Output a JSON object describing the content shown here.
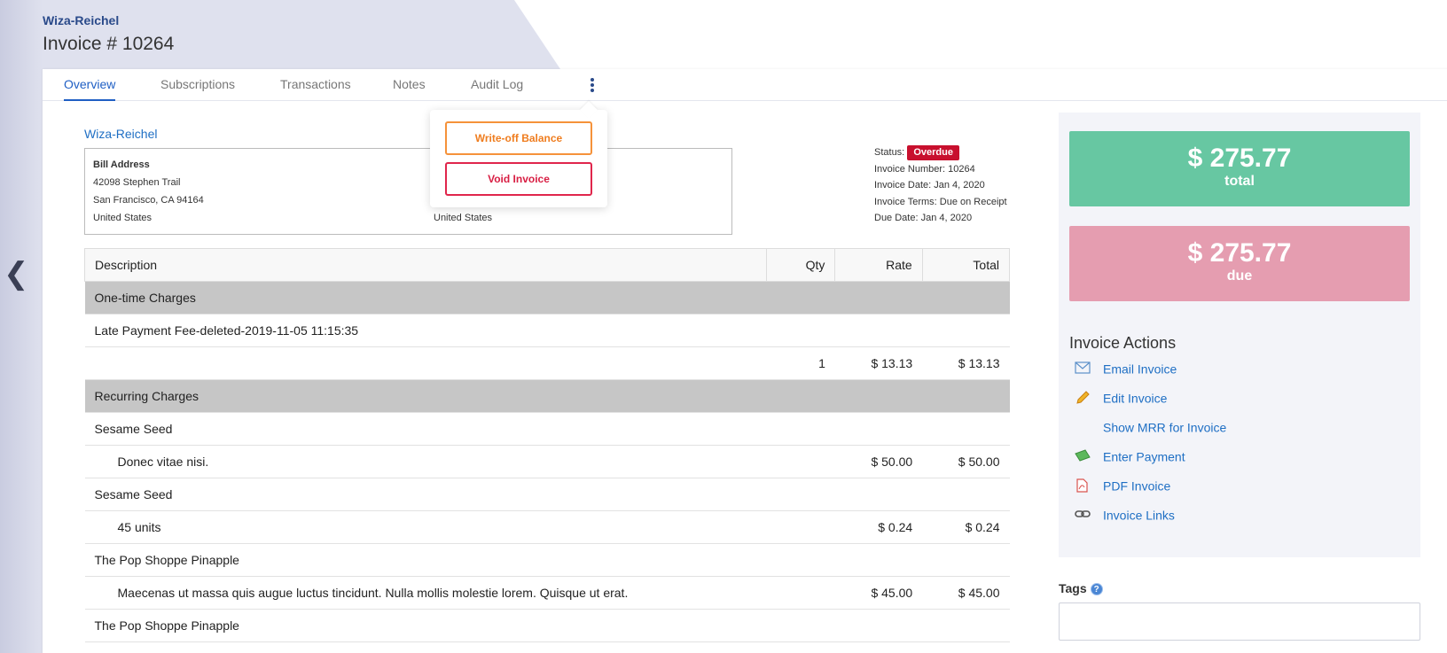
{
  "header": {
    "company": "Wiza-Reichel",
    "title": "Invoice # 10264"
  },
  "tabs": [
    {
      "label": "Overview",
      "active": true
    },
    {
      "label": "Subscriptions"
    },
    {
      "label": "Transactions"
    },
    {
      "label": "Notes"
    },
    {
      "label": "Audit Log"
    }
  ],
  "dropdown": {
    "writeoff": "Write-off Balance",
    "void": "Void Invoice"
  },
  "customer": {
    "name": "Wiza-Reichel",
    "bill_heading": "Bill Address",
    "bill_lines": [
      "42098 Stephen Trail",
      "San Francisco, CA 94164",
      "United States"
    ],
    "ship_country": "United States"
  },
  "status": {
    "status_label": "Status:",
    "status_value": "Overdue",
    "invoice_number": "Invoice Number: 10264",
    "invoice_date": "Invoice Date: Jan 4, 2020",
    "invoice_terms": "Invoice Terms: Due on Receipt",
    "due_date": "Due Date: Jan 4, 2020"
  },
  "table": {
    "headers": [
      "Description",
      "Qty",
      "Rate",
      "Total"
    ],
    "rows": [
      {
        "type": "section",
        "desc": "One-time Charges"
      },
      {
        "type": "item",
        "desc": "Late Payment Fee-deleted-2019-11-05 11:15:35"
      },
      {
        "type": "detail",
        "desc": "",
        "qty": "1",
        "rate": "$ 13.13",
        "total": "$ 13.13"
      },
      {
        "type": "section",
        "desc": "Recurring Charges"
      },
      {
        "type": "item",
        "desc": "Sesame Seed"
      },
      {
        "type": "detail",
        "desc": "Donec vitae nisi.",
        "qty": "",
        "rate": "$ 50.00",
        "total": "$ 50.00"
      },
      {
        "type": "item",
        "desc": "Sesame Seed"
      },
      {
        "type": "detail",
        "desc": "45 units",
        "qty": "",
        "rate": "$ 0.24",
        "total": "$ 0.24"
      },
      {
        "type": "item",
        "desc": "The Pop Shoppe Pinapple"
      },
      {
        "type": "detail",
        "desc": "Maecenas ut massa quis augue luctus tincidunt. Nulla mollis molestie lorem. Quisque ut erat.",
        "qty": "",
        "rate": "$ 45.00",
        "total": "$ 45.00"
      },
      {
        "type": "item",
        "desc": "The Pop Shoppe Pinapple"
      }
    ]
  },
  "summary": {
    "total_amount": "$ 275.77",
    "total_label": "total",
    "due_amount": "$ 275.77",
    "due_label": "due",
    "total_color": "#67c7a2",
    "due_color": "#e59db0"
  },
  "actions": {
    "title": "Invoice Actions",
    "items": [
      {
        "label": "Email Invoice",
        "icon": "envelope-icon"
      },
      {
        "label": "Edit Invoice",
        "icon": "pencil-icon"
      },
      {
        "label": "Show MRR for Invoice",
        "icon": ""
      },
      {
        "label": "Enter Payment",
        "icon": "money-icon"
      },
      {
        "label": "PDF Invoice",
        "icon": "pdf-icon"
      },
      {
        "label": "Invoice Links",
        "icon": "link-icon"
      }
    ]
  },
  "tags": {
    "label": "Tags",
    "help": "?"
  },
  "colors": {
    "accent": "#1f5fc4",
    "overdue": "#c8102e",
    "writeoff": "#ef7d1f",
    "void": "#d81e43"
  }
}
